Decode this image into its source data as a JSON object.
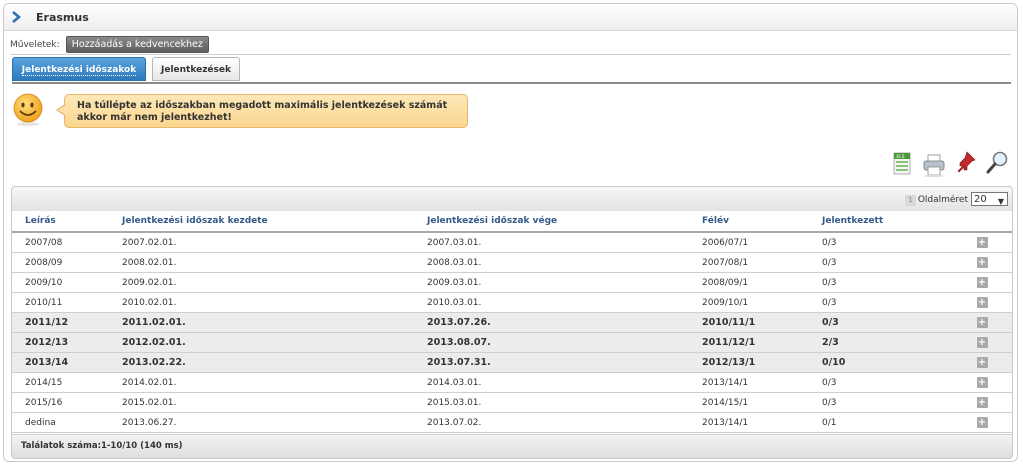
{
  "header": {
    "title": "Erasmus"
  },
  "operations": {
    "label": "Műveletek:",
    "add_favorite": "Hozzáadás a kedvencekhez"
  },
  "tabs": [
    {
      "label": "Jelentkezési időszakok",
      "active": true
    },
    {
      "label": "Jelentkezések",
      "active": false
    }
  ],
  "message": {
    "line1": "Ha túllépte az időszakban megadott maximális jelentkezések számát",
    "line2": "akkor már nem jelentkezhet!"
  },
  "toolbar": {
    "icons": [
      "excel-export-icon",
      "print-icon",
      "pin-icon",
      "search-icon"
    ]
  },
  "pager": {
    "page": "1",
    "page_size_label": "Oldalméret",
    "page_size": "20"
  },
  "table": {
    "columns": [
      "Leírás",
      "Jelentkezési időszak kezdete",
      "Jelentkezési időszak vége",
      "Félév",
      "Jelentkezett"
    ],
    "rows": [
      {
        "desc": "2007/08",
        "start": "2007.02.01.",
        "end": "2007.03.01.",
        "semester": "2006/07/1",
        "applied": "0/3",
        "bold": false
      },
      {
        "desc": "2008/09",
        "start": "2008.02.01.",
        "end": "2008.03.01.",
        "semester": "2007/08/1",
        "applied": "0/3",
        "bold": false
      },
      {
        "desc": "2009/10",
        "start": "2009.02.01.",
        "end": "2009.03.01.",
        "semester": "2008/09/1",
        "applied": "0/3",
        "bold": false
      },
      {
        "desc": "2010/11",
        "start": "2010.02.01.",
        "end": "2010.03.01.",
        "semester": "2009/10/1",
        "applied": "0/3",
        "bold": false
      },
      {
        "desc": "2011/12",
        "start": "2011.02.01.",
        "end": "2013.07.26.",
        "semester": "2010/11/1",
        "applied": "0/3",
        "bold": true
      },
      {
        "desc": "2012/13",
        "start": "2012.02.01.",
        "end": "2013.08.07.",
        "semester": "2011/12/1",
        "applied": "2/3",
        "bold": true
      },
      {
        "desc": "2013/14",
        "start": "2013.02.22.",
        "end": "2013.07.31.",
        "semester": "2012/13/1",
        "applied": "0/10",
        "bold": true
      },
      {
        "desc": "2014/15",
        "start": "2014.02.01.",
        "end": "2014.03.01.",
        "semester": "2013/14/1",
        "applied": "0/3",
        "bold": false
      },
      {
        "desc": "2015/16",
        "start": "2015.02.01.",
        "end": "2015.03.01.",
        "semester": "2014/15/1",
        "applied": "0/3",
        "bold": false
      },
      {
        "desc": "dedina",
        "start": "2013.06.27.",
        "end": "2013.07.02.",
        "semester": "2013/14/1",
        "applied": "0/1",
        "bold": false
      }
    ]
  },
  "footer": {
    "results": "Találatok száma:1-10/10 (140 ms)"
  }
}
